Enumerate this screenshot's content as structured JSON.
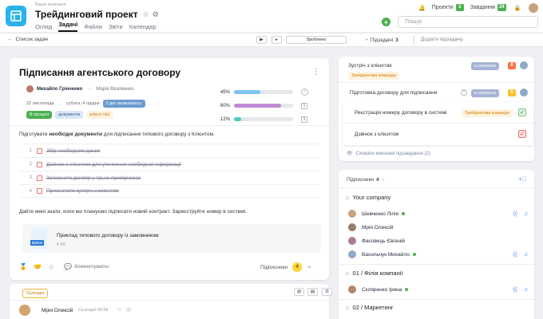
{
  "header": {
    "company": "Ваша компанія",
    "title": "Трейдинговий проект",
    "tabs": [
      "Огляд",
      "Задачі",
      "Файли",
      "Звіти",
      "Календар"
    ],
    "projects_label": "Проекти",
    "projects_count": "3",
    "tasks_label": "Завдання",
    "tasks_count": "24",
    "search_placeholder": "Пошук"
  },
  "toolbar": {
    "back_label": "Список задач",
    "done_label": "Зроблено",
    "subtasks_label": "Підзадачі",
    "subtasks_count": "3",
    "add_subtask_label": "Додати підзадачу"
  },
  "task": {
    "title": "Підписання агентського договору",
    "assignee": "Михайло Грінченко",
    "watcher": "Марія Вязовенко",
    "date_start": "22 листопада",
    "date_end": "субота, 4 грудня",
    "days_left": "2 дні залишилось",
    "tags": [
      "В процесі",
      "документи",
      "клієнт №1"
    ],
    "progress": [
      {
        "pct": "45%",
        "value": 45,
        "color": "#7cc4f2",
        "badge": ""
      },
      {
        "pct": "80%",
        "value": 80,
        "color": "#c08ad3",
        "badge": "1"
      },
      {
        "pct": "12%",
        "value": 12,
        "color": "#4ec9c0",
        "badge": "3"
      }
    ],
    "desc_before": "Підготувати ",
    "desc_bold": "необхідні документи",
    "desc_after": " для підписання типового договору з Клієнтом.",
    "checklist": [
      {
        "num": "1",
        "text": "Збір необхідних даних"
      },
      {
        "num": "2",
        "text": "Дзвінок з клієнтом для уточнення необхідної інформації"
      },
      {
        "num": "3",
        "text": "Заповнити договір у трьох примірниках"
      },
      {
        "num": "4",
        "text": "Призначити зустріч з клієнтом"
      }
    ],
    "note": "Дайте мені знати, коли ми плануємо підписати новий контракт. Зареєструйте номер в системі.",
    "file_name": "Приклад типового договору із замовником",
    "file_size": "6 Кб",
    "file_ext": "DOCX",
    "comment_label": "Коментувати",
    "subscribers_label": "Підписники",
    "subscribers_count": "4"
  },
  "comment": {
    "today_label": "Сьогодні",
    "author": "Мрія Олексій",
    "time": "Сьогодні 09:58"
  },
  "subtasks": {
    "items": [
      {
        "title": "Зустріч з клієнтом",
        "status": "в очікуванні",
        "num": "8",
        "tag": "Трейдингова команда"
      },
      {
        "title": "Підготовка договору для підписання",
        "status": "в очікуванні",
        "num": "6"
      }
    ],
    "nested": [
      {
        "title": "Реєстрація номеру договору в системі",
        "tag": "Трейдингова команда"
      },
      {
        "title": "Дзвінок з клієнтом"
      }
    ],
    "hide_done_label": "Сховати виконані підзавдання (2)"
  },
  "subscribers": {
    "label": "Підписники",
    "count": "4",
    "groups": [
      {
        "name": "Your company",
        "people": [
          "Шевченко Лілія",
          "Мрія Олексій",
          "Фасовець Євгеній",
          "Васильчук Михайло"
        ]
      },
      {
        "name": "01 / Філія компанії",
        "people": [
          "Скляренко Ірина"
        ]
      },
      {
        "name": "02 / Маркетинг",
        "people": []
      }
    ]
  },
  "colors": {
    "accent": "#29b3ea",
    "green": "#4caf50",
    "orange": "#ffa726",
    "purple": "#c08ad3"
  }
}
